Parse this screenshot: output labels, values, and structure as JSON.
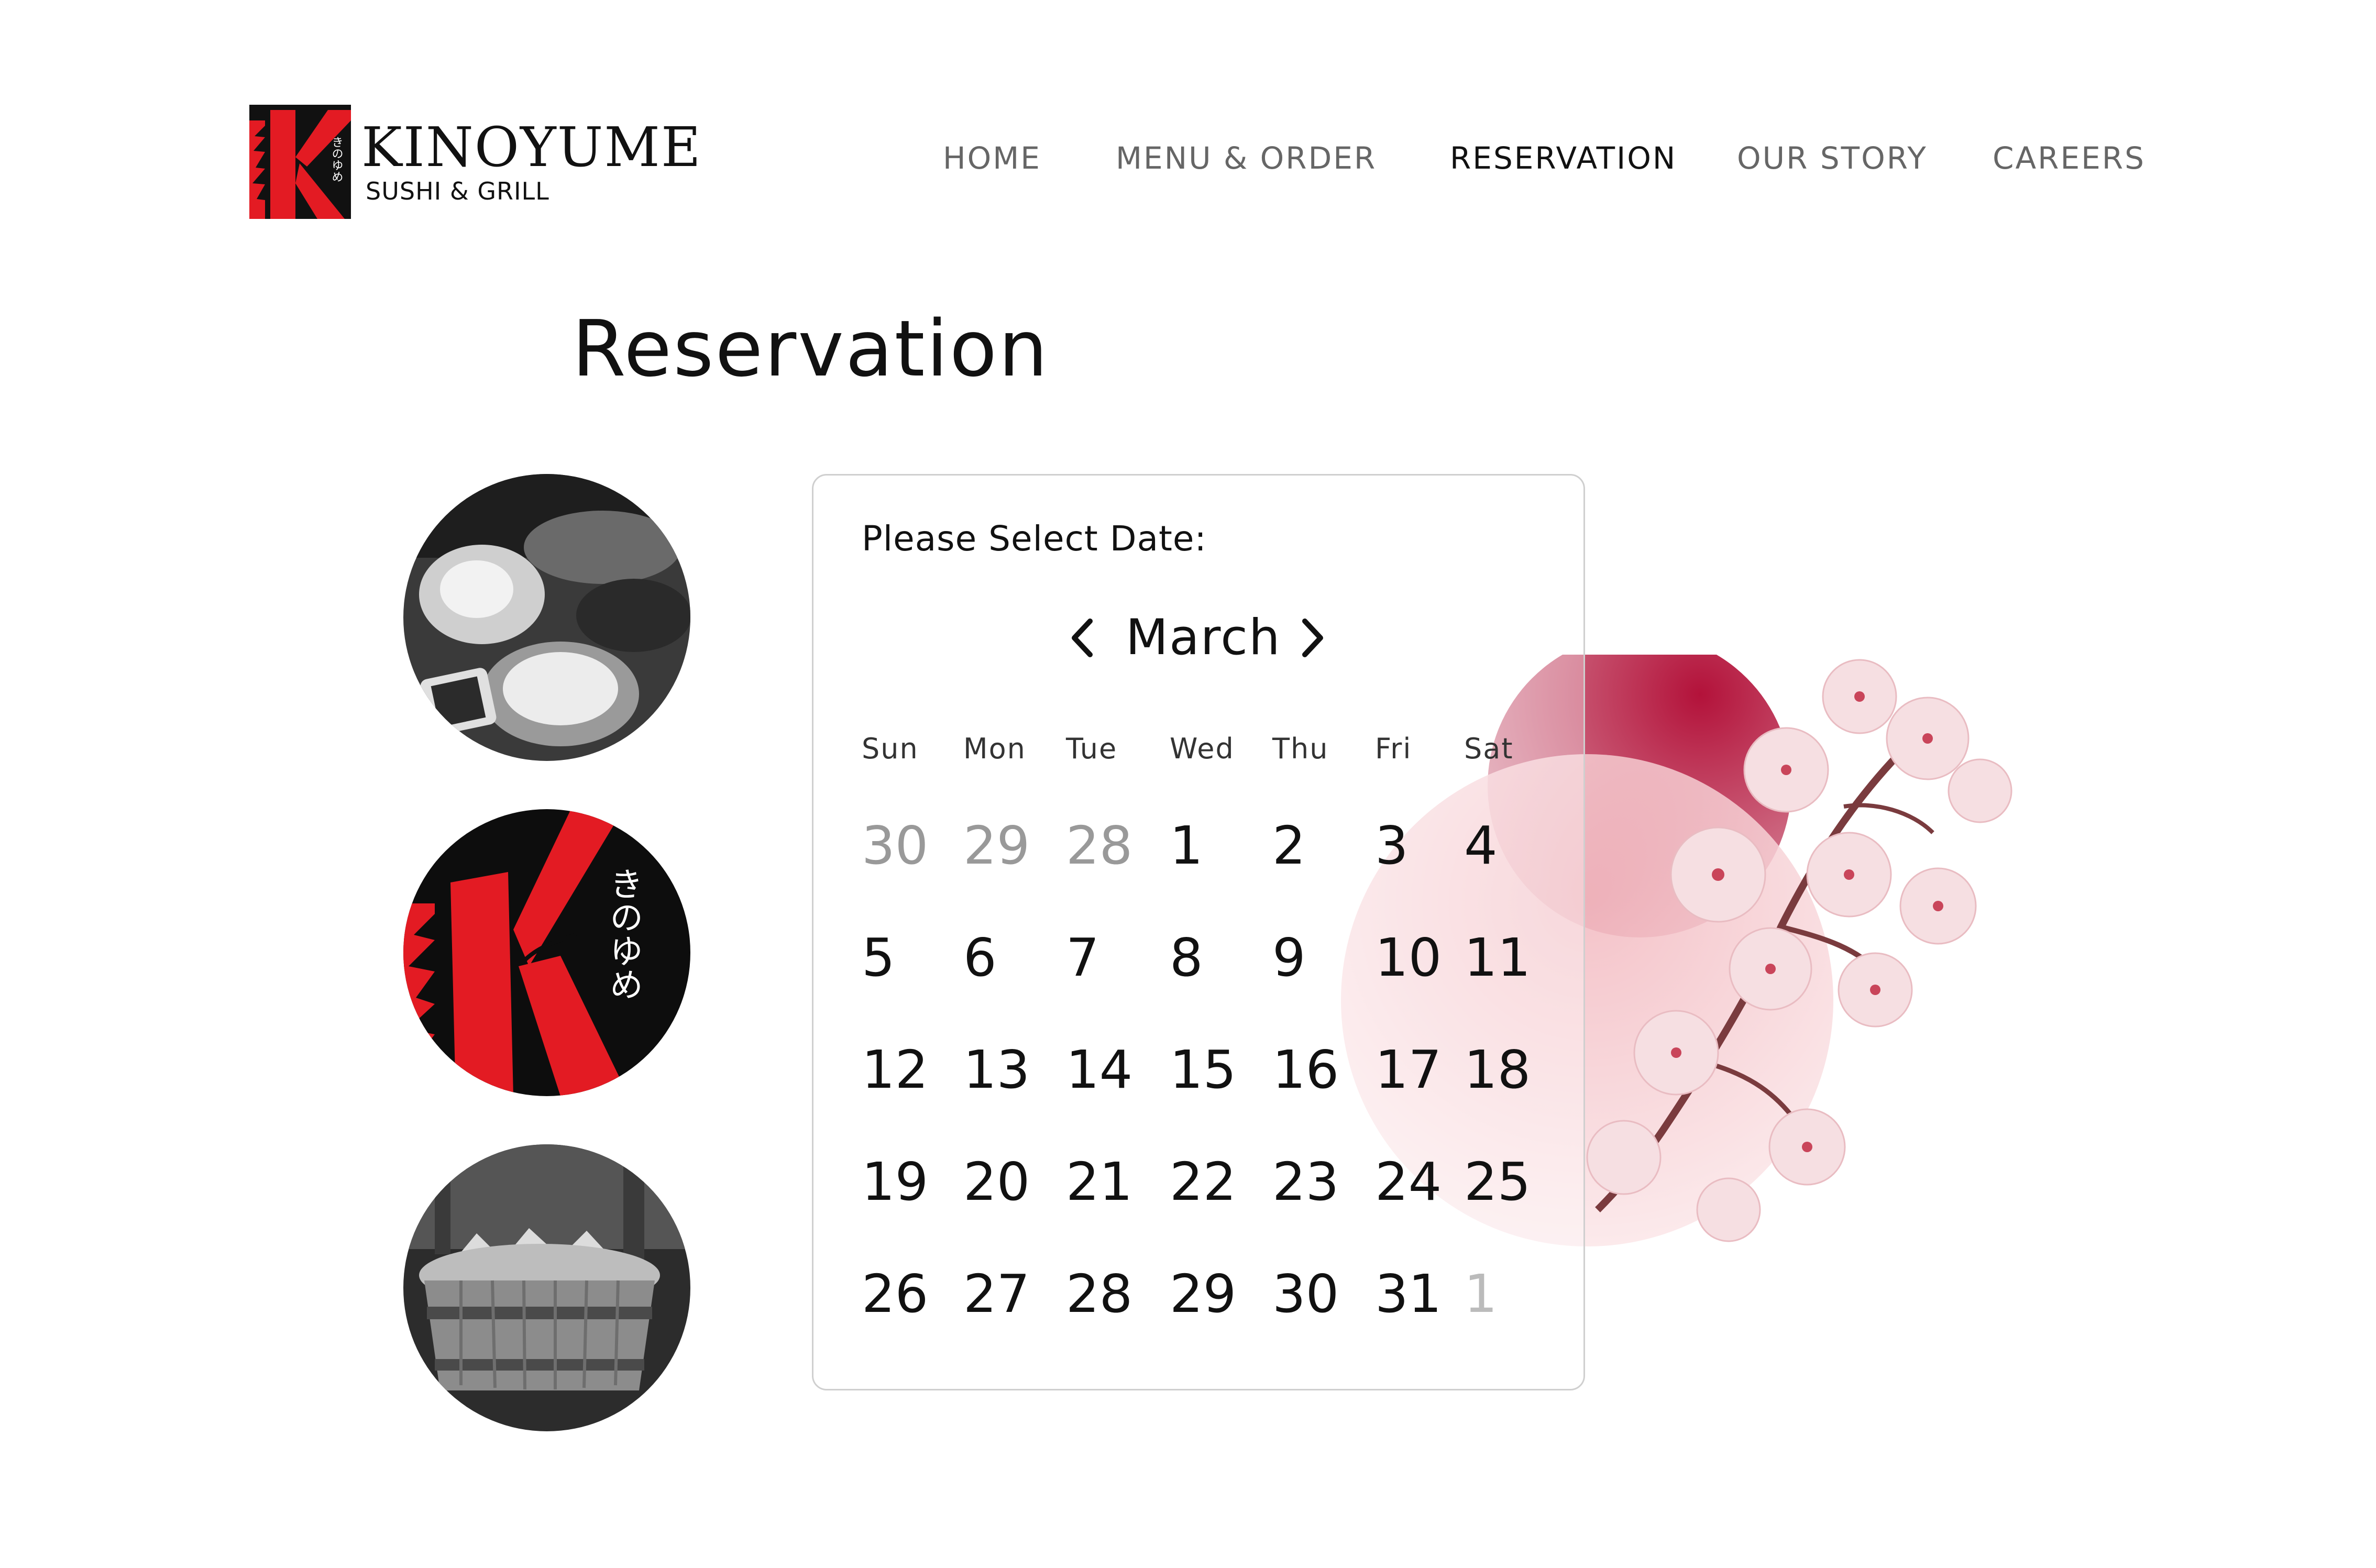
{
  "brand": {
    "name": "KINOYUME",
    "subtitle": "SUSHI & GRILL",
    "logo_letter": "K",
    "logo_kana": "きのゆめ",
    "colors": {
      "accent": "#e31b23",
      "dark": "#111111"
    }
  },
  "nav": {
    "items": [
      {
        "label": "HOME",
        "active": false
      },
      {
        "label": "MENU & ORDER",
        "active": false
      },
      {
        "label": "RESERVATION",
        "active": true
      },
      {
        "label": "OUR STORY",
        "active": false
      },
      {
        "label": "CAREERS",
        "active": false
      }
    ]
  },
  "page": {
    "title": "Reservation"
  },
  "calendar": {
    "prompt": "Please Select Date:",
    "month": "March",
    "prev_icon": "chevron-left-icon",
    "next_icon": "chevron-right-icon",
    "weekdays": [
      "Sun",
      "Mon",
      "Tue",
      "Wed",
      "Thu",
      "Fri",
      "Sat"
    ],
    "weeks": [
      [
        "30",
        "29",
        "28",
        "1",
        "2",
        "3",
        "4"
      ],
      [
        "5",
        "6",
        "7",
        "8",
        "9",
        "10",
        "11"
      ],
      [
        "12",
        "13",
        "14",
        "15",
        "16",
        "17",
        "18"
      ],
      [
        "19",
        "20",
        "21",
        "22",
        "23",
        "24",
        "25"
      ],
      [
        "26",
        "27",
        "28",
        "29",
        "30",
        "31",
        "1"
      ]
    ],
    "muted": [
      [
        0,
        0
      ],
      [
        0,
        1
      ],
      [
        0,
        2
      ],
      [
        4,
        6
      ]
    ]
  },
  "thumbnails": [
    {
      "name": "food-platter-photo"
    },
    {
      "name": "kinoyume-logo-circle",
      "kana": "きのゆめ"
    },
    {
      "name": "sushi-boat-photo"
    }
  ],
  "decor": {
    "name": "cherry-blossom-branch",
    "colors": {
      "deep": "#b3123a",
      "pink": "#f2b8bf",
      "blossom": "#f6dfe2"
    }
  }
}
